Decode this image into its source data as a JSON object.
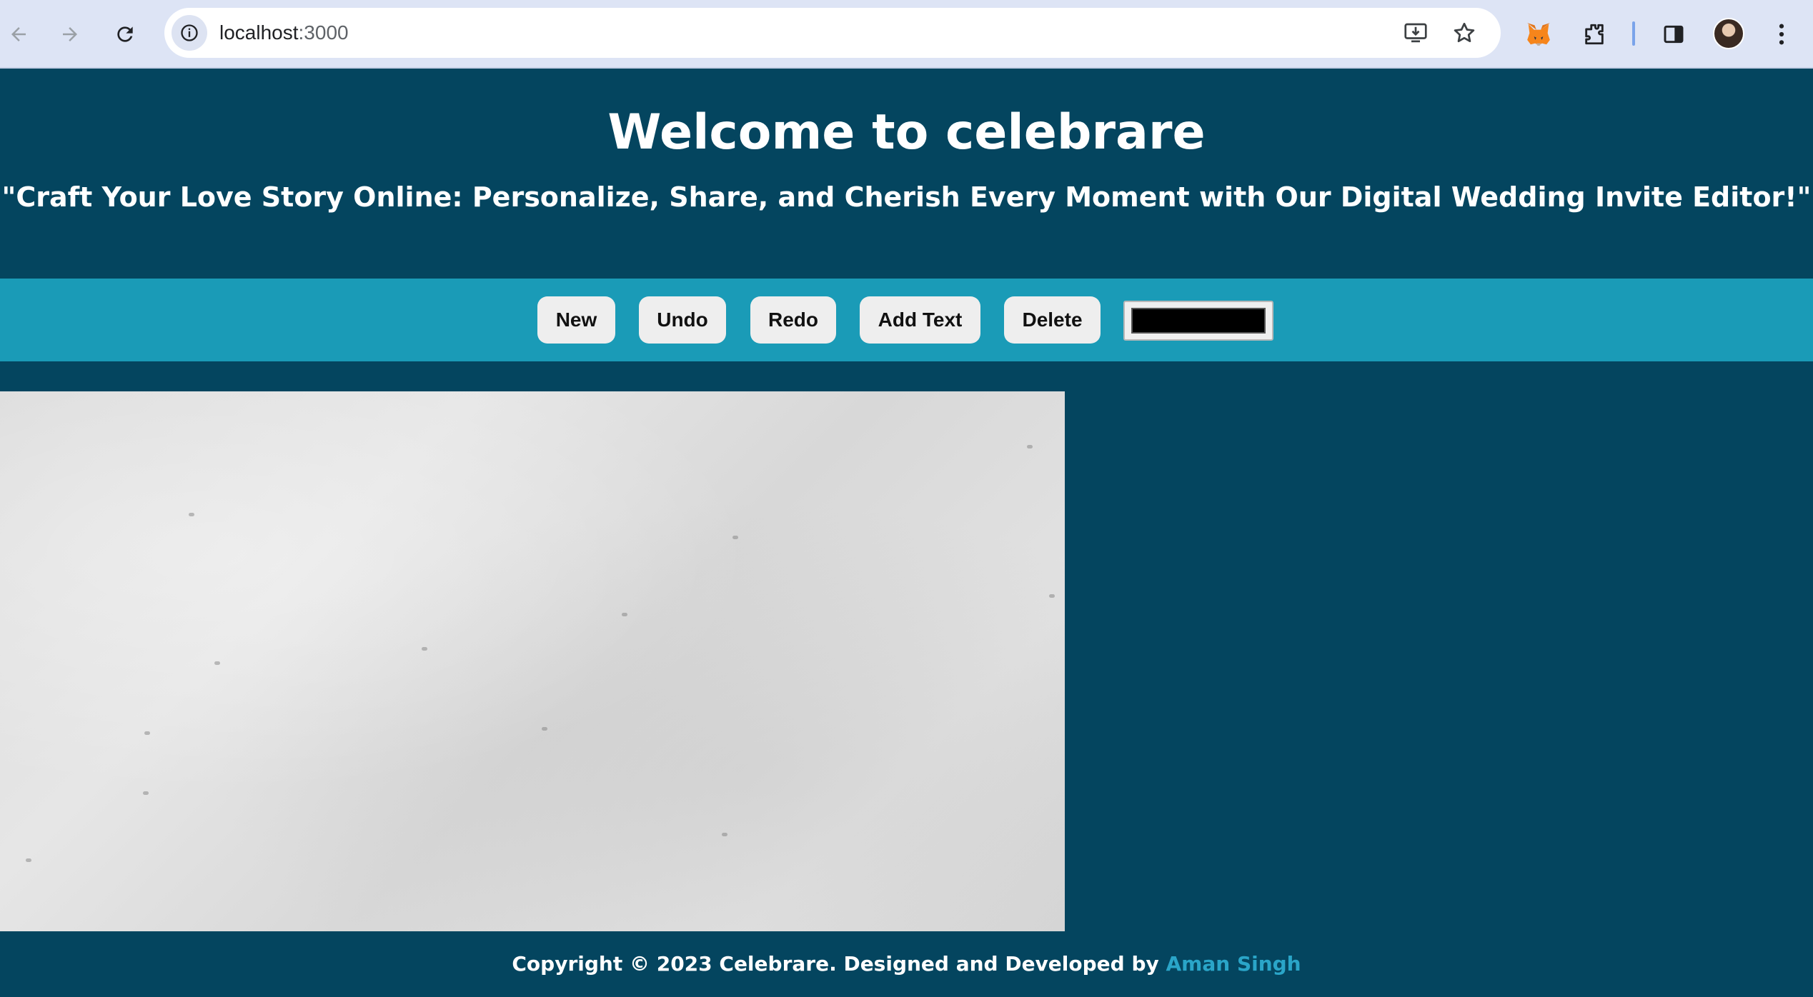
{
  "browser": {
    "url_host": "localhost",
    "url_port": ":3000",
    "icons": [
      "back-arrow-icon",
      "forward-arrow-icon",
      "reload-icon",
      "info-icon",
      "install-app-icon",
      "star-bookmark-icon",
      "metamask-fox-icon",
      "extensions-puzzle-icon",
      "side-panel-icon",
      "profile-avatar",
      "kebab-menu-icon"
    ]
  },
  "header": {
    "title": "Welcome to celebrare",
    "subtitle": "\"Craft Your Love Story Online: Personalize, Share, and Cherish Every Moment with Our Digital Wedding Invite Editor!\""
  },
  "toolbar": {
    "new_label": "New",
    "undo_label": "Undo",
    "redo_label": "Redo",
    "add_text_label": "Add Text",
    "delete_label": "Delete",
    "color_value": "#000000"
  },
  "footer": {
    "copyright_text": "Copyright © 2023 Celebrare. Designed and Developed by ",
    "author_link": "Aman Singh"
  },
  "colors": {
    "page_background": "#04455f",
    "toolbar_background": "#1a9bb7",
    "link_accent": "#2aa5c8",
    "canvas_background": "#e0e0e0"
  }
}
